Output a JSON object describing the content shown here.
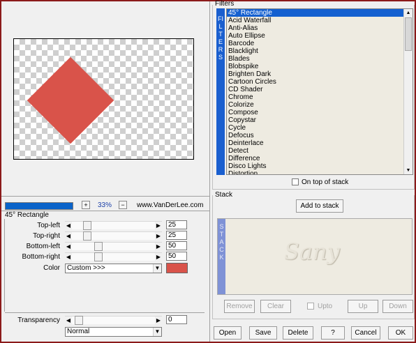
{
  "preview": {
    "zoom": "33%",
    "zoom_minus": "+",
    "zoom_plus": "−",
    "site": "www.VanDerLee.com",
    "shape_color": "#d9534a"
  },
  "params": {
    "title": "45° Rectangle",
    "rows": [
      {
        "label": "Top-left",
        "value": "25",
        "level": 0.25
      },
      {
        "label": "Top-right",
        "value": "25",
        "level": 0.25
      },
      {
        "label": "Bottom-left",
        "value": "50",
        "level": 0.5
      },
      {
        "label": "Bottom-right",
        "value": "50",
        "level": 0.5
      }
    ],
    "color_label": "Color",
    "color_select": "Custom >>>",
    "color_swatch": "#d9534a"
  },
  "transparency": {
    "label": "Transparency",
    "value": "0",
    "blend": "Normal"
  },
  "filters": {
    "title": "Filters",
    "strip": "FILTERS",
    "items": [
      "45° Rectangle",
      "Acid Waterfall",
      "Anti-Alias",
      "Auto Ellipse",
      "Barcode",
      "Blacklight",
      "Blades",
      "Blobspike",
      "Brighten Dark",
      "Cartoon Circles",
      "CD Shader",
      "Chrome",
      "Colorize",
      "Compose",
      "Copystar",
      "Cycle",
      "Defocus",
      "Deinterlace",
      "Detect",
      "Difference",
      "Disco Lights",
      "Distortion"
    ],
    "selected_index": 0,
    "on_top": "On top of stack"
  },
  "stack": {
    "title": "Stack",
    "add_label": "Add to stack",
    "strip": "STACK",
    "watermark": "Sany",
    "remove": "Remove",
    "clear": "Clear",
    "upto": "Upto",
    "up": "Up",
    "down": "Down"
  },
  "footer": {
    "open": "Open",
    "save": "Save",
    "delete": "Delete",
    "help": "?",
    "cancel": "Cancel",
    "ok": "OK"
  }
}
